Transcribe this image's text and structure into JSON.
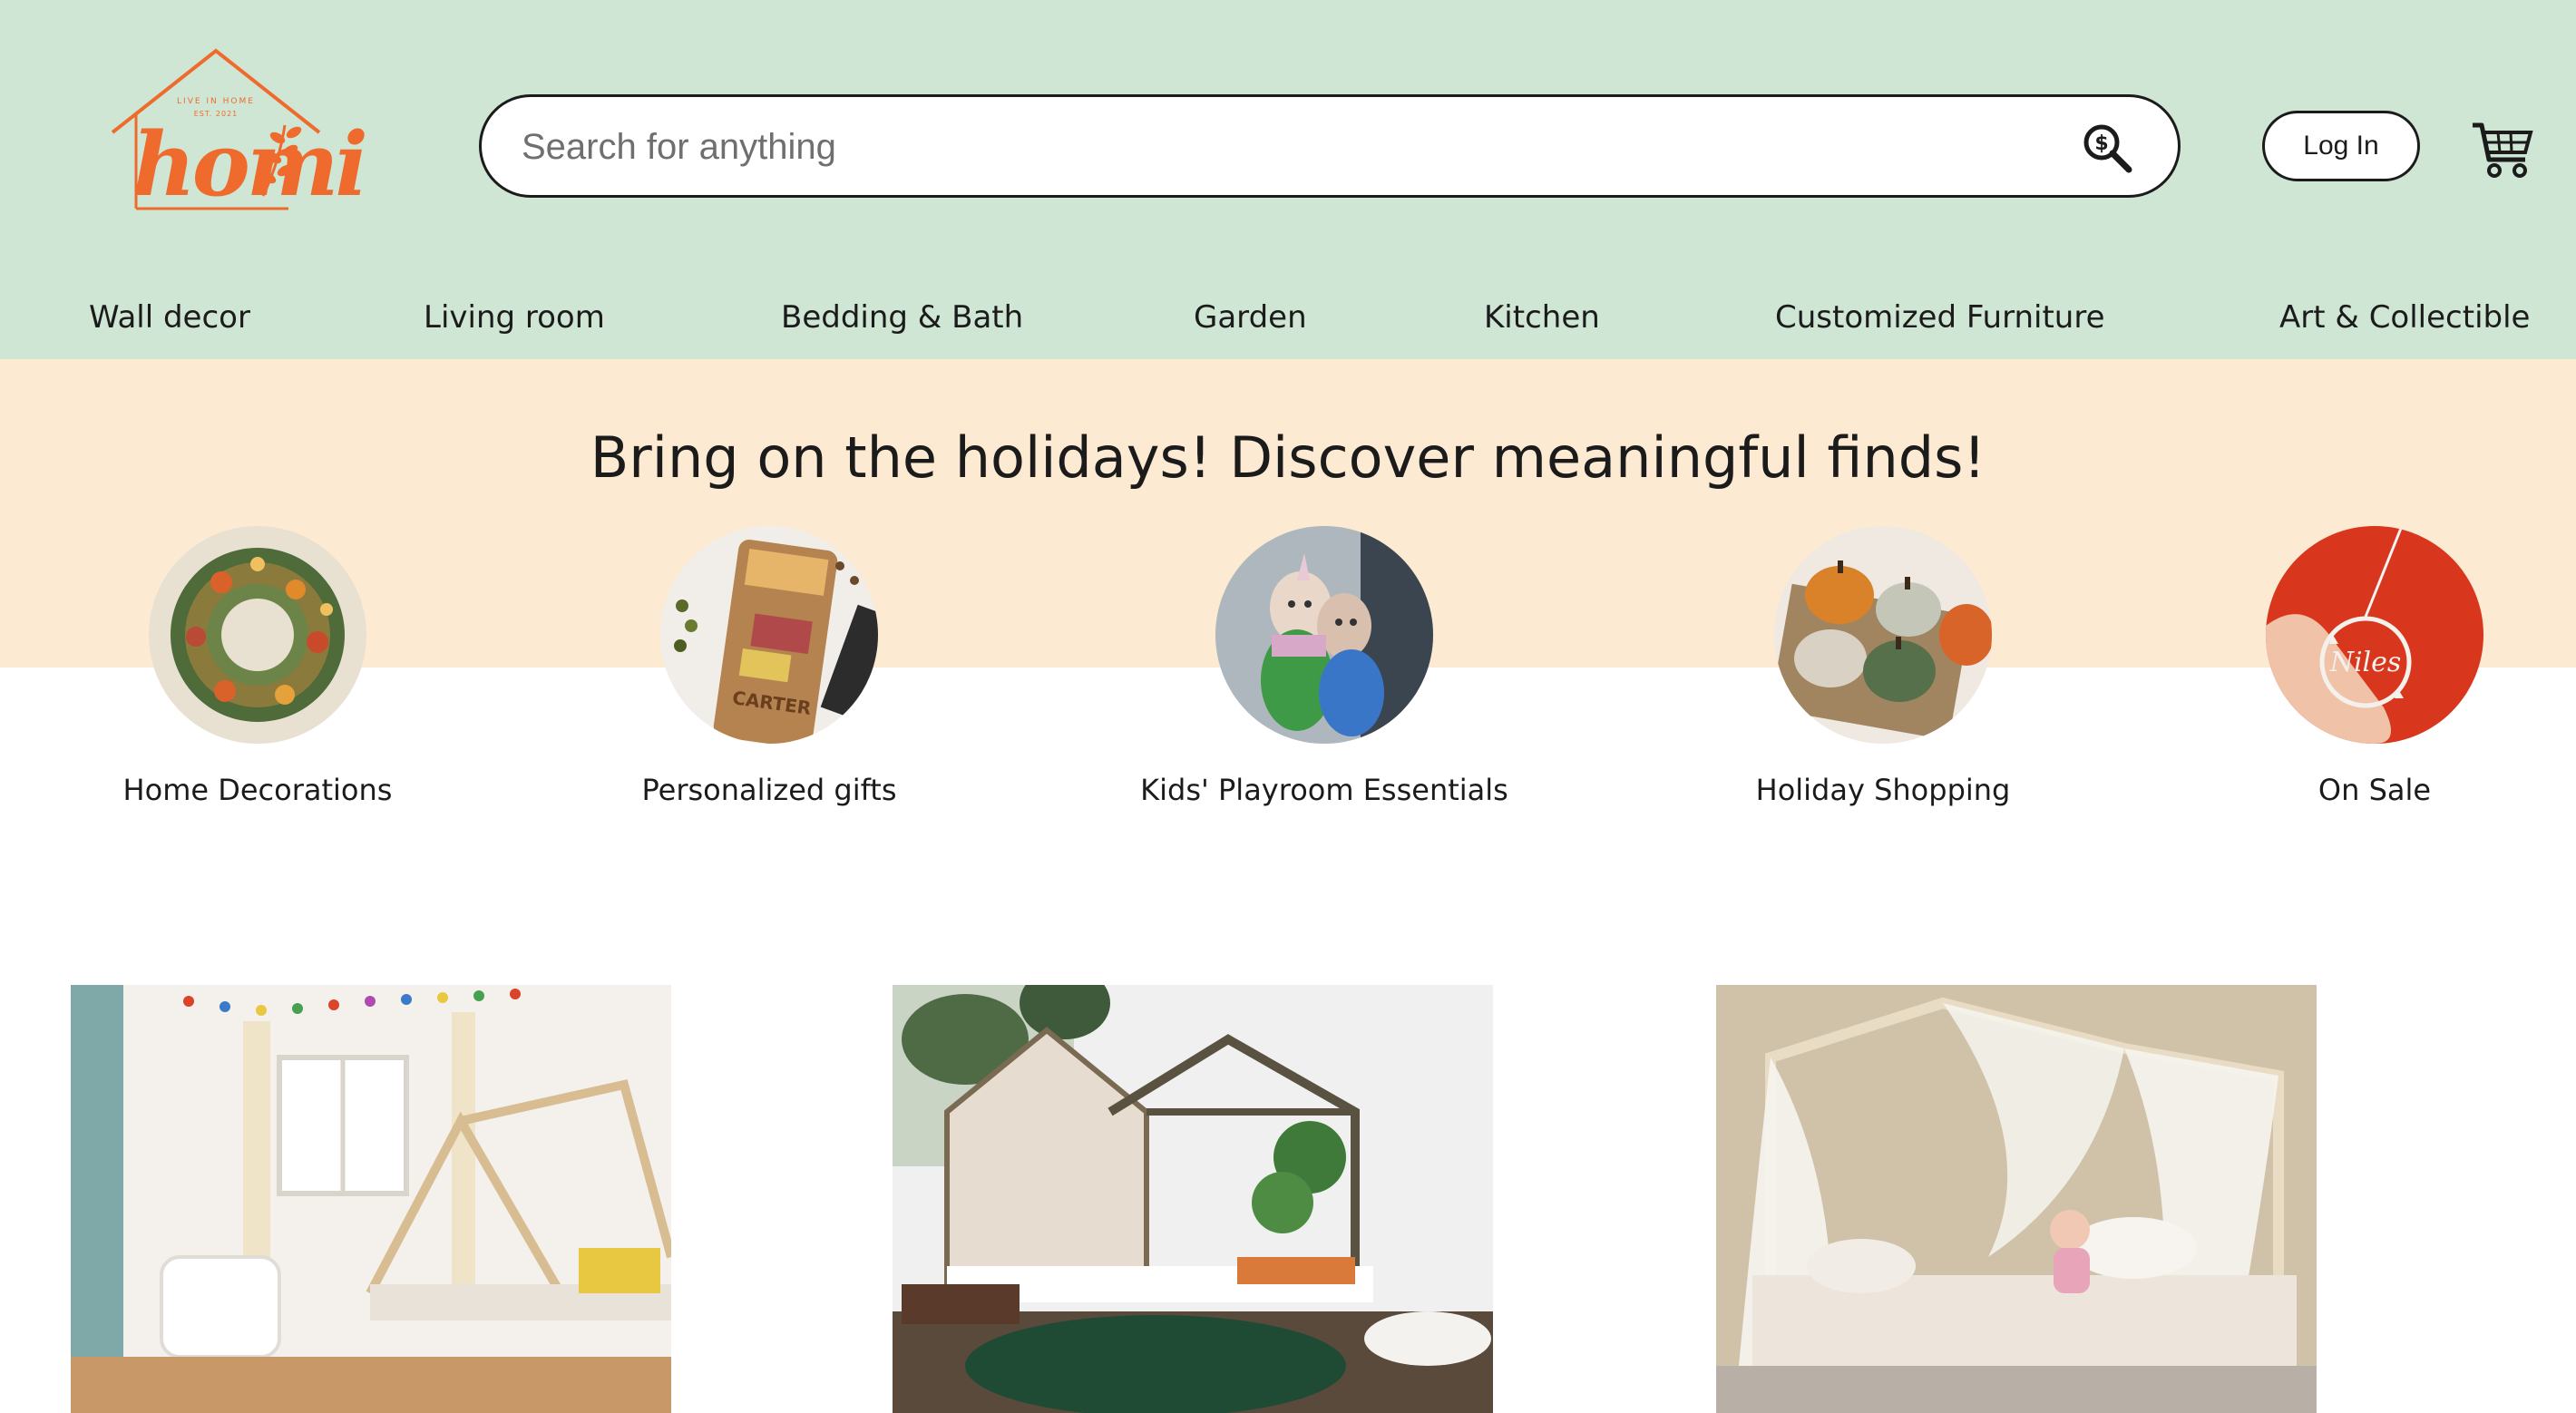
{
  "logo": {
    "text": "homi",
    "tagline": "LIVE IN HOME · EST. 2021",
    "icon": "house-leaf-logo",
    "color": "#ee6b2d"
  },
  "search": {
    "placeholder": "Search for anything",
    "value": "",
    "icon": "search-dollar-icon"
  },
  "header": {
    "login_label": "Log In",
    "cart_icon": "shopping-cart-icon",
    "background": "#cfe6d4"
  },
  "nav": {
    "items": [
      {
        "label": "Wall decor"
      },
      {
        "label": "Living room"
      },
      {
        "label": "Bedding & Bath"
      },
      {
        "label": "Garden"
      },
      {
        "label": "Kitchen"
      },
      {
        "label": "Customized Furniture"
      },
      {
        "label": "Art & Collectible"
      }
    ]
  },
  "promo": {
    "title": "Bring on the holidays! Discover meaningful finds!",
    "background": "#fcead2",
    "categories": [
      {
        "label": "Home Decorations",
        "image": "wreath-photo"
      },
      {
        "label": "Personalized gifts",
        "image": "cutting-board-photo"
      },
      {
        "label": "Kids' Playroom Essentials",
        "image": "plush-toys-photo"
      },
      {
        "label": "Holiday Shopping",
        "image": "knit-pumpkins-photo"
      },
      {
        "label": "On Sale",
        "image": "ornament-photo"
      }
    ]
  },
  "products": [
    {
      "image": "house-bed-nursery-photo"
    },
    {
      "image": "house-bed-leaf-rug-photo"
    },
    {
      "image": "canopy-house-bed-photo"
    }
  ]
}
